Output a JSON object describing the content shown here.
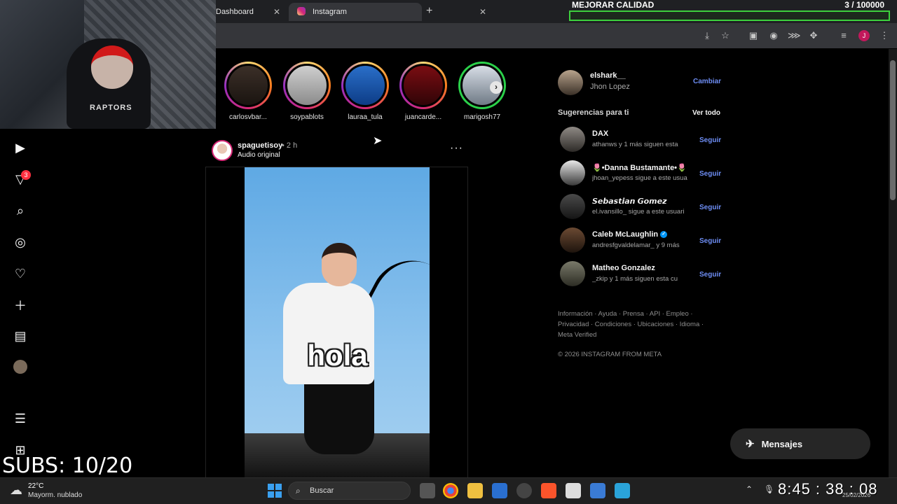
{
  "browser": {
    "tabs": [
      {
        "label": "Dashboard"
      },
      {
        "label": "Instagram"
      }
    ],
    "new_tab": "+",
    "close": "✕"
  },
  "stream_overlay": {
    "quality_label": "MEJORAR CALIDAD",
    "quality_count": "3 / 100000",
    "quality_progress": 3e-05,
    "subs": "SUBS: 10/20",
    "clock": "8:45 : 38 : 08"
  },
  "nav": {
    "notifications_badge": "3"
  },
  "stories": [
    {
      "name": "carlosvbar..."
    },
    {
      "name": "soypablots"
    },
    {
      "name": "lauraa_tula"
    },
    {
      "name": "juancarde..."
    },
    {
      "name": "marigosh77"
    }
  ],
  "post": {
    "username": "spaguetisoy",
    "time": "• 2 h",
    "audio": "Audio original",
    "more": "···",
    "caption": "hola"
  },
  "profile": {
    "username": "elshark__",
    "full_name": "Jhon Lopez",
    "switch_label": "Cambiar"
  },
  "suggestions": {
    "title": "Sugerencias para ti",
    "see_all": "Ver todo",
    "follow_label": "Seguir",
    "items": [
      {
        "name": "DAX",
        "sub": "athanws y 1 más siguen esta"
      },
      {
        "name": "🌷•Danna Bustamante•🌷",
        "sub": "jhoan_yepess sigue a este usua"
      },
      {
        "name": "𝙎𝙚𝙗𝙖𝙨𝙩𝙞𝙖𝙣 𝙂𝙤𝙢𝙚𝙯",
        "sub": "el.ivansillo_ sigue a este usuari"
      },
      {
        "name": "Caleb McLaughlin",
        "sub": "andresfgvaldelamar_ y 9 más"
      },
      {
        "name": "Matheo Gonzalez",
        "sub": "_zkip y 1 más siguen esta cu"
      }
    ]
  },
  "footer": {
    "links": "Información · Ayuda · Prensa · API · Empleo · Privacidad · Condiciones · Ubicaciones · Idioma · Meta Verified",
    "copyright": "© 2026 INSTAGRAM FROM META"
  },
  "messages": {
    "label": "Mensajes"
  },
  "taskbar": {
    "weather_temp": "22°C",
    "weather_desc": "Mayorm. nublado",
    "search": "Buscar",
    "date": "25/02/2026"
  }
}
